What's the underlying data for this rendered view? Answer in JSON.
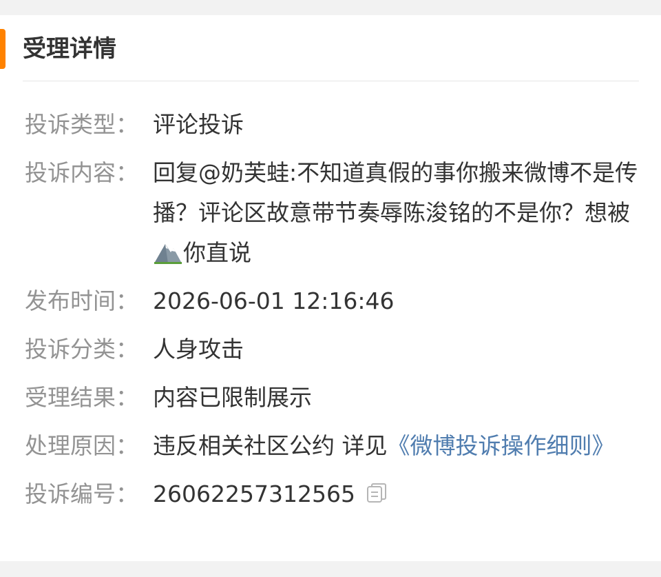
{
  "title": "受理详情",
  "colors": {
    "accent": "#ff8200",
    "link": "#507daf",
    "label": "#939393",
    "value": "#333333"
  },
  "rows": {
    "type": {
      "label": "投诉类型：",
      "value": "评论投诉"
    },
    "content": {
      "label": "投诉内容：",
      "before_emoji": "回复@奶芙蛙:不知道真假的事你搬来微博不是传播？评论区故意带节奏辱陈浚铭的不是你？想被",
      "emoji_icon": "mountain-emoji-icon",
      "after_emoji": "你直说"
    },
    "time": {
      "label": "发布时间：",
      "value": "2026-06-01 12:16:46"
    },
    "category": {
      "label": "投诉分类：",
      "value": "人身攻击"
    },
    "result": {
      "label": "受理结果：",
      "value": "内容已限制展示"
    },
    "reason": {
      "label": "处理原因：",
      "value": "违反相关社区公约 详见",
      "link": "《微博投诉操作细则》"
    },
    "number": {
      "label": "投诉编号：",
      "value": "26062257312565",
      "copy_icon": "copy-icon"
    }
  }
}
